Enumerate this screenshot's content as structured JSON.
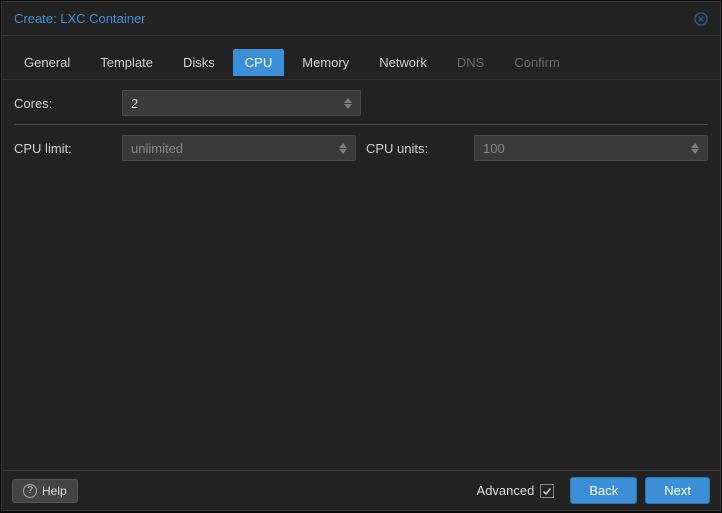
{
  "colors": {
    "accent": "#3b8fd6"
  },
  "titlebar": {
    "title": "Create: LXC Container"
  },
  "tabs": [
    {
      "label": "General",
      "active": false,
      "disabled": false
    },
    {
      "label": "Template",
      "active": false,
      "disabled": false
    },
    {
      "label": "Disks",
      "active": false,
      "disabled": false
    },
    {
      "label": "CPU",
      "active": true,
      "disabled": false
    },
    {
      "label": "Memory",
      "active": false,
      "disabled": false
    },
    {
      "label": "Network",
      "active": false,
      "disabled": false
    },
    {
      "label": "DNS",
      "active": false,
      "disabled": true
    },
    {
      "label": "Confirm",
      "active": false,
      "disabled": true
    }
  ],
  "form": {
    "cores": {
      "label": "Cores:",
      "value": "2",
      "placeholder": ""
    },
    "cpulimit": {
      "label": "CPU limit:",
      "value": "",
      "placeholder": "unlimited"
    },
    "cpuunits": {
      "label": "CPU units:",
      "value": "",
      "placeholder": "100"
    }
  },
  "footer": {
    "help_label": "Help",
    "advanced_label": "Advanced",
    "advanced_checked": true,
    "back_label": "Back",
    "next_label": "Next"
  }
}
